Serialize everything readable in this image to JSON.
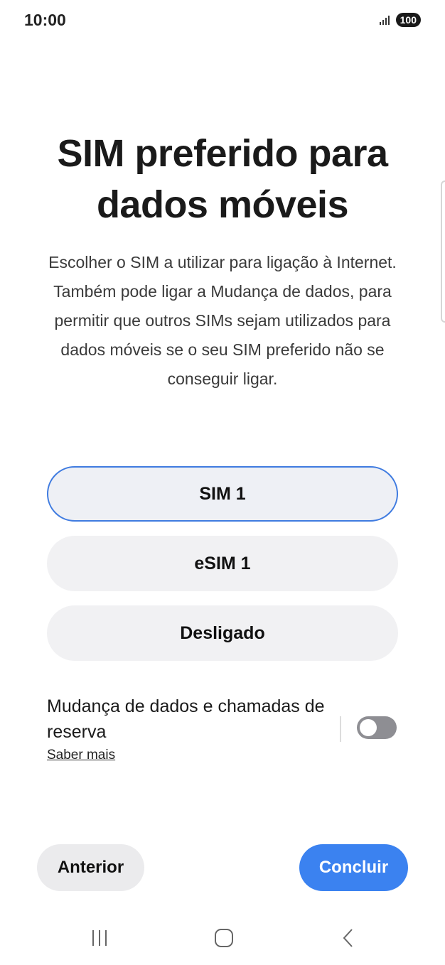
{
  "status_bar": {
    "time": "10:00",
    "battery": "100",
    "signal_icon": "signal-icon"
  },
  "title": "SIM preferido para dados móveis",
  "description": "Escolher o SIM a utilizar para ligação à Internet. Também pode ligar a Mudança de dados, para permitir que outros SIMs sejam utilizados para dados móveis se o seu SIM preferido não se conseguir ligar.",
  "options": [
    {
      "label": "SIM 1",
      "selected": true
    },
    {
      "label": "eSIM 1",
      "selected": false
    },
    {
      "label": "Desligado",
      "selected": false
    }
  ],
  "data_switch": {
    "label": "Mudança de dados e chamadas de reserva",
    "learn_more": "Saber mais",
    "enabled": false
  },
  "buttons": {
    "previous": "Anterior",
    "done": "Concluir"
  },
  "colors": {
    "accent": "#3b82f0",
    "selected_border": "#3f7be0",
    "option_bg": "#f1f1f3",
    "toggle_off": "#8e8e93"
  },
  "nav_bar": {
    "recents_icon": "recents-icon",
    "home_icon": "home-icon",
    "back_icon": "back-icon"
  }
}
